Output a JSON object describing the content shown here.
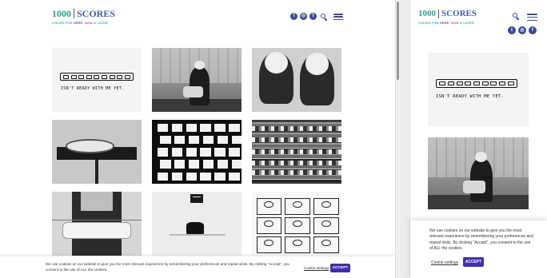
{
  "brand": {
    "logo_number": "1000",
    "logo_word": "SCORES",
    "tagline_part1": "VOICES FOR ",
    "tagline_part2": "HERE",
    "tagline_part3": ", ",
    "tagline_part4": "NOW",
    "tagline_part5": " & LATER"
  },
  "header": {
    "social_icons": [
      "facebook-icon",
      "instagram-icon",
      "twitter-icon"
    ],
    "facebook_glyph": "f",
    "instagram_glyph": "◎",
    "twitter_glyph": "t"
  },
  "tiles": {
    "score_caption": "ISN'T READY WITH ME YET."
  },
  "cookie": {
    "message": "We use cookies on our website to give you the most relevant experience by remembering your preferences and repeat visits. By clicking \"Accept\", you consent to the use of ALL the cookies.",
    "settings_label": "Cookie settings",
    "accept_label": "ACCEPT"
  },
  "colors": {
    "brand_teal": "#2f9d8e",
    "brand_blue": "#3f5fa8",
    "icon_navy": "#3a4a9a",
    "accept_button": "#3c2fa8"
  }
}
